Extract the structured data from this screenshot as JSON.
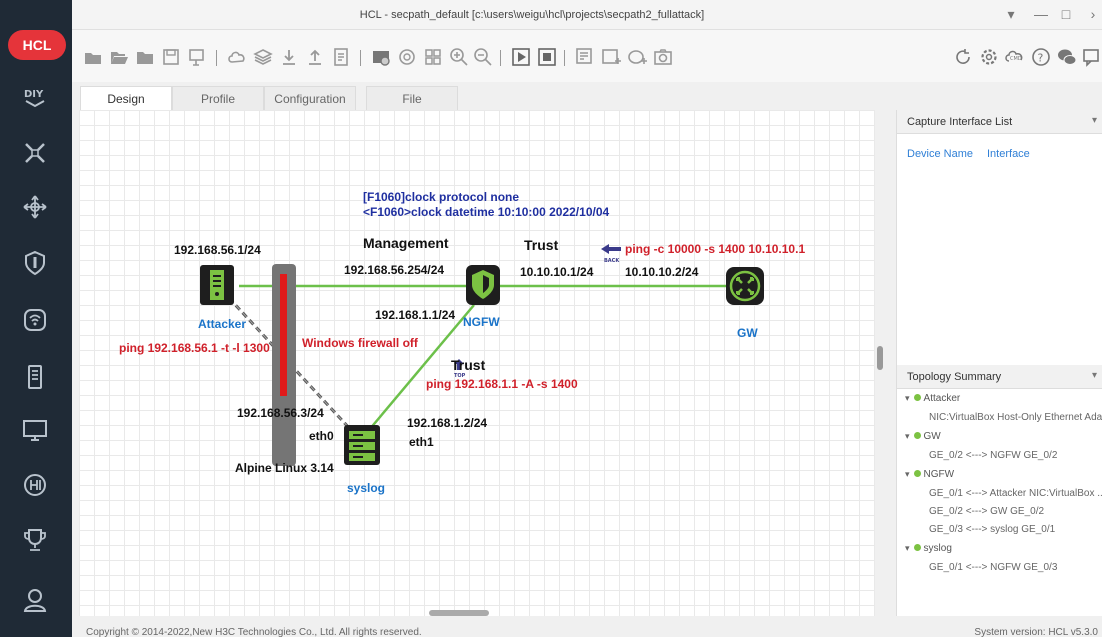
{
  "window": {
    "title": "HCL - secpath_default [c:\\users\\weigu\\hcl\\projects\\secpath2_fullattack]"
  },
  "sidebar": {
    "logo": "HCL",
    "items": [
      "diy-icon",
      "topology-icon",
      "move-icon",
      "shield-icon",
      "wireless-icon",
      "server-icon",
      "monitor-icon",
      "h3c-icon",
      "trophy-icon",
      "user-icon"
    ]
  },
  "tabs": [
    {
      "label": "Design",
      "active": true
    },
    {
      "label": "Profile",
      "active": false
    },
    {
      "label": "Configuration",
      "active": false
    },
    {
      "label": "File",
      "active": false
    }
  ],
  "topology": {
    "devices": {
      "attacker": "Attacker",
      "ngfw": "NGFW",
      "gw": "GW",
      "syslog": "syslog"
    },
    "labels": {
      "cmd1": "[F1060]clock protocol none",
      "cmd2": "<F1060>clock datetime 10:10:00 2022/10/04",
      "management": "Management",
      "trust_top": "Trust",
      "trust_mid": "Trust",
      "ping_gw": "ping -c 10000 -s 1400 10.10.10.1",
      "ip_attacker": "192.168.56.1/24",
      "ip_ngfw_mgmt": "192.168.56.254/24",
      "ip_ngfw_trust": "10.10.10.1/24",
      "ip_gw": "10.10.10.2/24",
      "ip_ngfw_syslog": "192.168.1.1/24",
      "ping_attacker": "ping 192.168.56.1 -t -l 1300",
      "firewall": "Windows firewall off",
      "ping_ngfw": "ping 192.168.1.1 -A -s 1400",
      "ip_syslog_eth0": "192.168.56.3/24",
      "ip_syslog_eth1": "192.168.1.2/24",
      "eth0": "eth0",
      "eth1": "eth1",
      "alpine": "Alpine Linux 3.14",
      "back": "BACK",
      "top": "TOP"
    }
  },
  "capture_panel": {
    "title": "Capture Interface List",
    "col_device": "Device Name",
    "col_interface": "Interface"
  },
  "summary_panel": {
    "title": "Topology Summary",
    "nodes": [
      {
        "name": "Attacker",
        "links": [
          "NIC:VirtualBox Host-Only Ethernet Ada..."
        ]
      },
      {
        "name": "GW",
        "links": [
          "GE_0/2 <---> NGFW GE_0/2"
        ]
      },
      {
        "name": "NGFW",
        "links": [
          "GE_0/1 <---> Attacker NIC:VirtualBox ...",
          "GE_0/2 <---> GW GE_0/2",
          "GE_0/3 <---> syslog GE_0/1"
        ]
      },
      {
        "name": "syslog",
        "links": [
          "GE_0/1 <---> NGFW GE_0/3"
        ]
      }
    ]
  },
  "footer": {
    "copyright": "Copyright © 2014-2022,New H3C Technologies Co., Ltd. All rights reserved.",
    "version": "System version: HCL v5.3.0"
  },
  "colors": {
    "link_green": "#6cc04a",
    "device_bg": "#1e1e1e",
    "device_green": "#7cc242",
    "ngfw_blue": "#1a73c8",
    "firewall_red": "#e01a1a",
    "sidebar_bg": "#1f2a36"
  }
}
